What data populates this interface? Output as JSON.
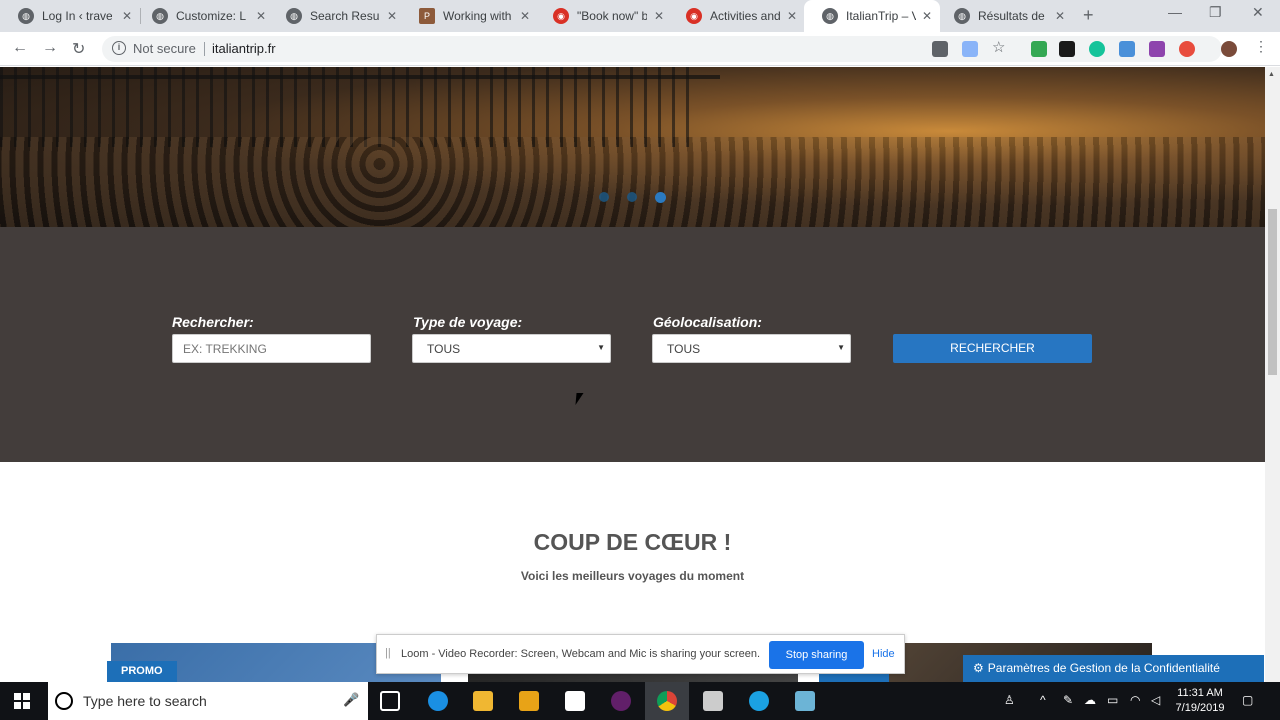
{
  "browser": {
    "tabs": [
      {
        "title": "Log In ‹ travel"
      },
      {
        "title": "Customize: Lo"
      },
      {
        "title": "Search Results"
      },
      {
        "title": "Working with"
      },
      {
        "title": "\"Book now\" bu"
      },
      {
        "title": "Activities and"
      },
      {
        "title": "ItalianTrip – Vo"
      },
      {
        "title": "Résultats de re"
      }
    ],
    "address": {
      "security": "Not secure",
      "url": "italiantrip.fr"
    },
    "window": {
      "minimize": "—",
      "restore": "❐",
      "close": "✕"
    }
  },
  "hero": {
    "slides": 3,
    "active_slide": 3
  },
  "search": {
    "keyword_label": "Rechercher:",
    "keyword_placeholder": "EX: TREKKING",
    "type_label": "Type de voyage:",
    "type_value": "TOUS",
    "geo_label": "Géolocalisation:",
    "geo_value": "TOUS",
    "submit_label": "RECHERCHER"
  },
  "featured": {
    "title": "COUP DE CŒUR !",
    "subtitle": "Voici les meilleurs voyages du moment",
    "badges": [
      "PROMO",
      "PROMO"
    ]
  },
  "loom": {
    "text": "Loom - Video Recorder: Screen, Webcam and Mic is sharing your screen.",
    "stop_label": "Stop sharing",
    "hide_label": "Hide"
  },
  "privacy": {
    "label": "Paramètres de Gestion de la Confidentialité"
  },
  "taskbar": {
    "search_placeholder": "Type here to search",
    "time": "11:31 AM",
    "date": "7/19/2019"
  },
  "colors": {
    "accent": "#2776c2",
    "band": "#433d3b",
    "heading": "#555555"
  }
}
